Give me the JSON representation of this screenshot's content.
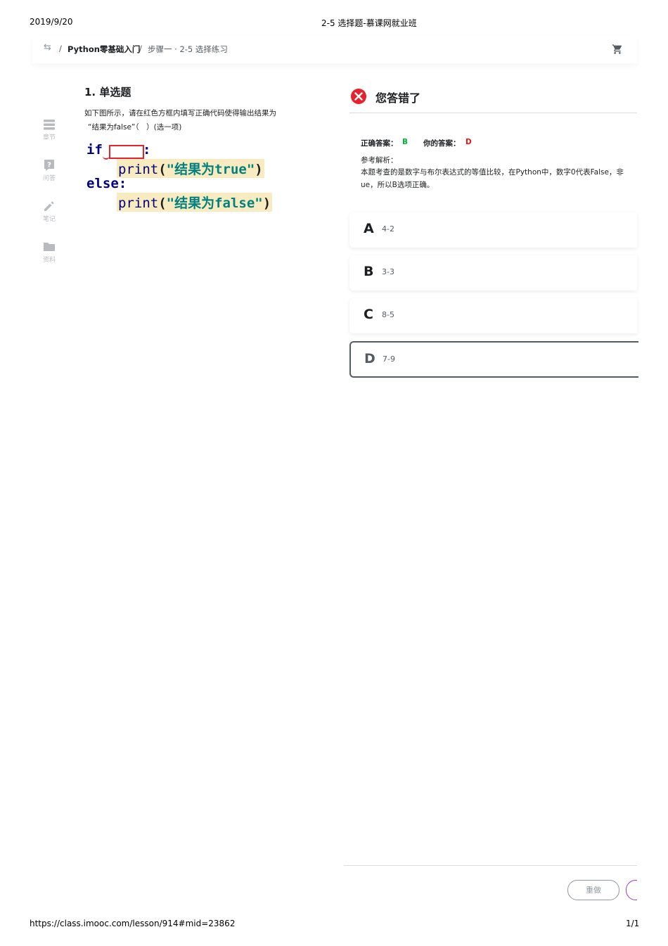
{
  "print_header": {
    "date": "2019/9/20",
    "title": "2-5 选择题-慕课网就业班"
  },
  "print_footer": {
    "url": "https://class.imooc.com/lesson/914#mid=23862",
    "page": "1/1"
  },
  "nav": {
    "sep1": "/",
    "course": "Python零基础入门",
    "sep2": "/",
    "step": "步骤一 · 2-5 选择练习"
  },
  "sidebar": [
    {
      "label": "章节",
      "icon": "chapter-icon"
    },
    {
      "label": "问答",
      "icon": "question-icon"
    },
    {
      "label": "笔记",
      "icon": "note-icon"
    },
    {
      "label": "资料",
      "icon": "folder-icon"
    }
  ],
  "question": {
    "title": "1. 单选题",
    "text_line1": "如下图所示，请在红色方框内填写正确代码使得输出结果为",
    "text_line2": "“结果为false”（　）(选一项)",
    "code": {
      "if_kw": "if",
      "colon": ":",
      "print_fn": "print",
      "open": "(",
      "str_true": "\"结果为true\"",
      "close": ")",
      "else_kw": "else",
      "str_false": "\"结果为false\""
    }
  },
  "result": {
    "status": "您答错了",
    "correct_label": "正确答案：",
    "correct_value": "B",
    "yours_label": "你的答案：",
    "yours_value": "D",
    "analysis_label": "参考解析：",
    "analysis_line1": "本题考查的是数字与布尔表达式的等值比较，在Python中，数字0代表False，非",
    "analysis_line2": "ue，所以B选项正确。",
    "colors": {
      "correct": "#00b43c",
      "wrong": "#f01414",
      "error_icon": "#e8222d"
    }
  },
  "options": [
    {
      "letter": "A",
      "text": "4-2",
      "selected": false
    },
    {
      "letter": "B",
      "text": "3-3",
      "selected": false
    },
    {
      "letter": "C",
      "text": "8-5",
      "selected": false
    },
    {
      "letter": "D",
      "text": "7-9",
      "selected": true
    }
  ],
  "footer": {
    "redo_label": "重做"
  }
}
